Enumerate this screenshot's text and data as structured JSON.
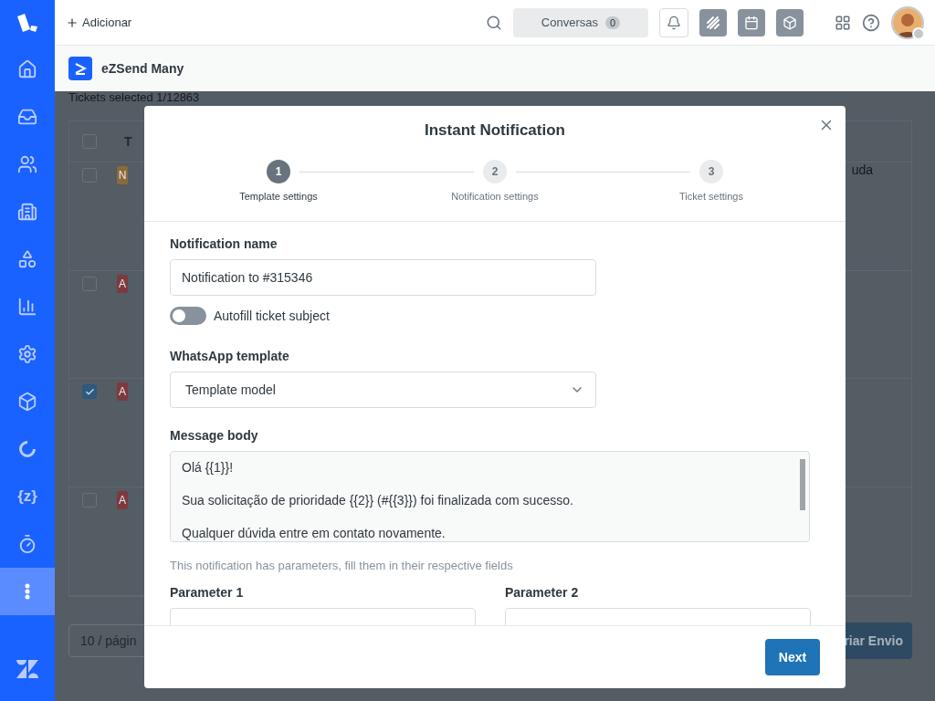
{
  "sidebar": {
    "items": [
      {
        "kind": "home",
        "selected": false
      },
      {
        "kind": "inbox",
        "selected": false
      },
      {
        "kind": "users",
        "selected": false
      },
      {
        "kind": "building",
        "selected": false
      },
      {
        "kind": "shapes",
        "selected": false
      },
      {
        "kind": "chart",
        "selected": false
      },
      {
        "kind": "settings",
        "selected": false
      },
      {
        "kind": "box",
        "selected": false
      },
      {
        "kind": "swirl",
        "selected": false
      },
      {
        "kind": "text",
        "label": "{z}",
        "selected": false
      },
      {
        "kind": "timer",
        "selected": false
      },
      {
        "kind": "more",
        "selected": true
      }
    ]
  },
  "topbar": {
    "add_label": "Adicionar",
    "conversations": {
      "label": "Conversas",
      "count": "0"
    }
  },
  "app": {
    "name": "eZSend Many"
  },
  "background": {
    "selection_info": "Tickets selected 1/12863",
    "column_2": "T",
    "select_all_checked": false,
    "rows": [
      {
        "checked": false,
        "badge": "N",
        "color": "#8a6a3a",
        "text": "uda"
      },
      {
        "checked": false,
        "badge": "A",
        "color": "#7d3a3e"
      },
      {
        "checked": true,
        "badge": "A",
        "color": "#7d3a3e"
      },
      {
        "checked": false,
        "badge": "A",
        "color": "#7d3a3e"
      }
    ],
    "pagination": "10 / págin",
    "create_button": "riar Envio"
  },
  "modal": {
    "title": "Instant Notification",
    "steps": [
      {
        "number": "1",
        "label": "Template settings",
        "selected": true
      },
      {
        "number": "2",
        "label": "Notification settings",
        "selected": false
      },
      {
        "number": "3",
        "label": "Ticket settings",
        "selected": false
      }
    ],
    "notification_name": {
      "label": "Notification name",
      "value": "Notification to #315346"
    },
    "autofill": {
      "label": "Autofill ticket subject",
      "on": false
    },
    "template": {
      "label": "WhatsApp template",
      "value": "Template model"
    },
    "message_body": {
      "label": "Message body",
      "value": "Olá {{1}}!\n\nSua solicitação de prioridade {{2}} (#{{3}}) foi finalizada com sucesso.\n\nQualquer dúvida entre em contato novamente."
    },
    "hint": "This notification has parameters, fill them in their respective fields",
    "parameters": [
      {
        "label": "Parameter 1"
      },
      {
        "label": "Parameter 2"
      }
    ],
    "next_button": "Next"
  }
}
